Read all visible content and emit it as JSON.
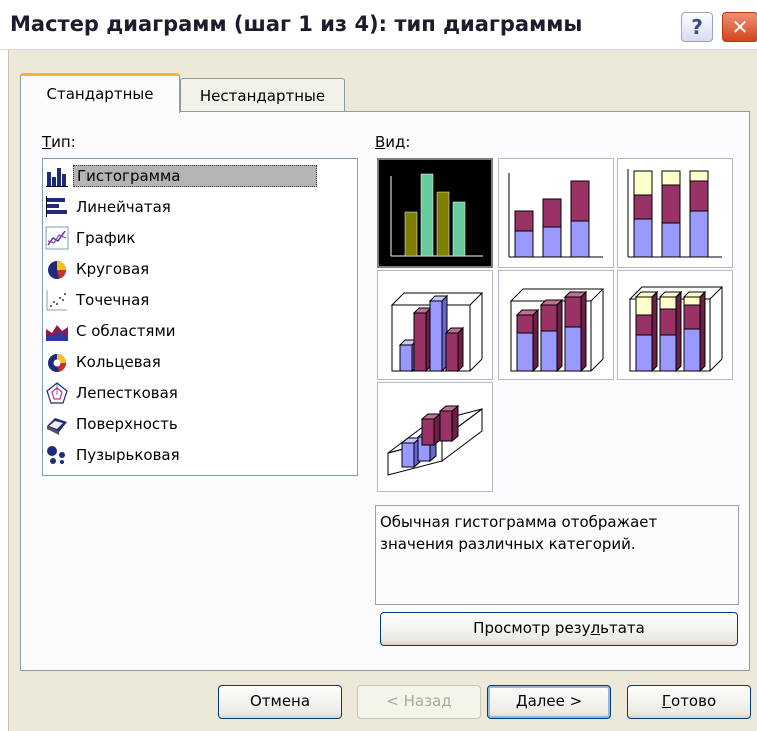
{
  "window": {
    "title": "Мастер диаграмм (шаг 1 из 4): тип диаграммы",
    "help_glyph": "?",
    "close_glyph": "✕"
  },
  "tabs": [
    {
      "label": "Стандартные",
      "active": true
    },
    {
      "label": "Нестандартные",
      "active": false
    }
  ],
  "type_label": {
    "underlined": "Т",
    "rest": "ип:"
  },
  "view_label": {
    "underlined": "В",
    "rest": "ид:"
  },
  "chart_types": [
    {
      "label": "Гистограмма",
      "icon": "column-chart-icon",
      "selected": true
    },
    {
      "label": "Линейчатая",
      "icon": "bar-chart-icon"
    },
    {
      "label": "График",
      "icon": "line-chart-icon"
    },
    {
      "label": "Круговая",
      "icon": "pie-chart-icon"
    },
    {
      "label": "Точечная",
      "icon": "scatter-chart-icon"
    },
    {
      "label": "С областями",
      "icon": "area-chart-icon"
    },
    {
      "label": "Кольцевая",
      "icon": "doughnut-chart-icon"
    },
    {
      "label": "Лепестковая",
      "icon": "radar-chart-icon"
    },
    {
      "label": "Поверхность",
      "icon": "surface-chart-icon"
    },
    {
      "label": "Пузырьковая",
      "icon": "bubble-chart-icon"
    }
  ],
  "subtypes": [
    {
      "name": "clustered-column",
      "selected": true
    },
    {
      "name": "stacked-column"
    },
    {
      "name": "100-stacked-column"
    },
    {
      "name": "clustered-column-3d-effect"
    },
    {
      "name": "stacked-column-3d-effect"
    },
    {
      "name": "100-stacked-column-3d-effect"
    },
    {
      "name": "3d-column"
    }
  ],
  "description": "Обычная гистограмма отображает значения различных категорий.",
  "preview_button": {
    "before": "Просмотр резу",
    "underlined": "л",
    "after": "ьтата"
  },
  "footer": {
    "cancel": "Отмена",
    "back": "< Назад",
    "next": {
      "underlined": "Д",
      "rest": "алее >"
    },
    "finish": {
      "underlined": "Г",
      "rest": "отово"
    }
  },
  "colors": {
    "periwinkle": "#9999ff",
    "plum": "#993366",
    "cream": "#ffffcc",
    "olive": "#808000",
    "mint": "#66cc99",
    "selection": "#b4b4b4"
  }
}
